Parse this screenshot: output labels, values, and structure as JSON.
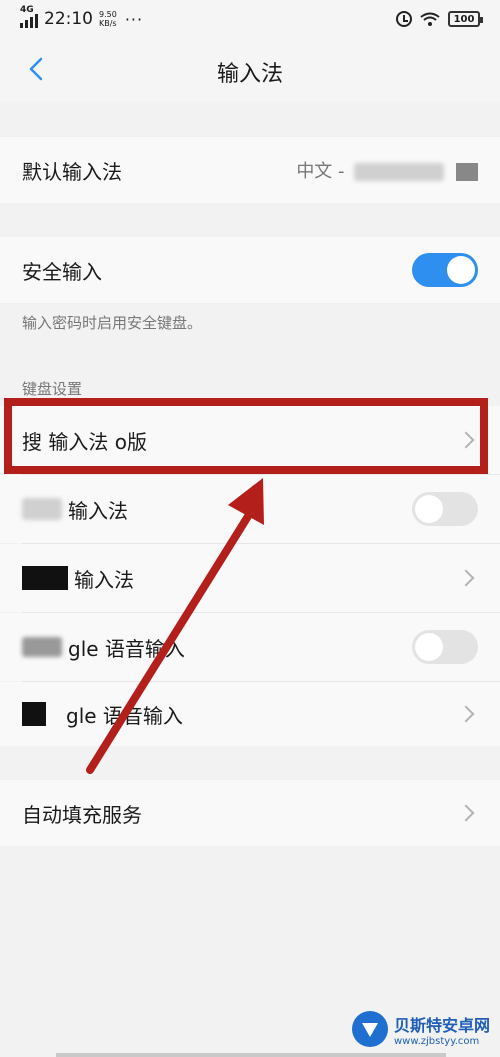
{
  "status_bar": {
    "network": "4G",
    "time": "22:10",
    "speed_value": "9.50",
    "speed_unit": "KB/s",
    "more": "···",
    "battery": "100"
  },
  "nav": {
    "title": "输入法"
  },
  "default_ime": {
    "label": "默认输入法",
    "value": "中文 -"
  },
  "secure_input": {
    "label": "安全输入",
    "enabled": true,
    "description": "输入密码时启用安全键盘。"
  },
  "keyboard_settings": {
    "header": "键盘设置",
    "items": [
      {
        "label": "搜 输入法 o版",
        "type": "link"
      },
      {
        "label": "输入法",
        "type": "toggle",
        "enabled": false
      },
      {
        "label": "输入法",
        "type": "link"
      },
      {
        "label": "gle 语音输入",
        "type": "toggle",
        "enabled": false
      },
      {
        "label": "gle 语音输入",
        "type": "link"
      }
    ]
  },
  "autofill": {
    "label": "自动填充服务"
  },
  "watermark": {
    "name": "贝斯特安卓网",
    "url": "www.zjbstyy.com"
  },
  "colors": {
    "accent": "#2f8ff0",
    "highlight": "#b3201c"
  }
}
